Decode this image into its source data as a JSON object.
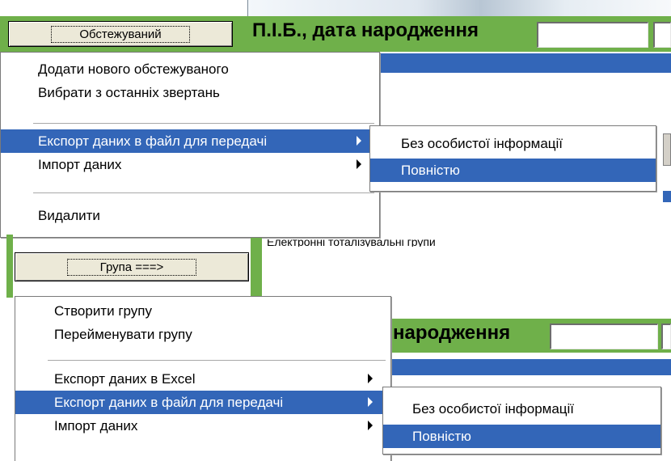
{
  "top_section": {
    "button_label": "Обстежуваний",
    "pib_label": "П.І.Б., дата народження"
  },
  "menu1": {
    "items": [
      {
        "label": "Додати нового обстежуваного"
      },
      {
        "label": "Вибрати з останніх звертань"
      },
      {
        "label": "Експорт даних в файл для передачі",
        "submenu": true,
        "highlighted": true
      },
      {
        "label": "Імпорт даних",
        "submenu": true
      },
      {
        "label": "Видалити"
      }
    ],
    "submenu": [
      {
        "label": "Без особистої інформації"
      },
      {
        "label": "Повністю",
        "highlighted": true
      }
    ]
  },
  "bottom_section": {
    "partial_text": "Електронні тоталізувальні групи",
    "button_label": "Група   ===>",
    "pib_label_partial": "а народження"
  },
  "menu2": {
    "items": [
      {
        "label": "Створити групу"
      },
      {
        "label": "Перейменувати групу"
      },
      {
        "label": "Експорт даних в Excel",
        "submenu": true
      },
      {
        "label": "Експорт даних в файл для передачі",
        "submenu": true,
        "highlighted": true
      },
      {
        "label": "Імпорт даних",
        "submenu": true
      }
    ],
    "submenu": [
      {
        "label": "Без особистої інформації"
      },
      {
        "label": "Повністю",
        "highlighted": true
      }
    ]
  },
  "colors": {
    "highlight": "#3366b8",
    "panel_green": "#6fb04a",
    "menu_bg": "#ffffff"
  }
}
